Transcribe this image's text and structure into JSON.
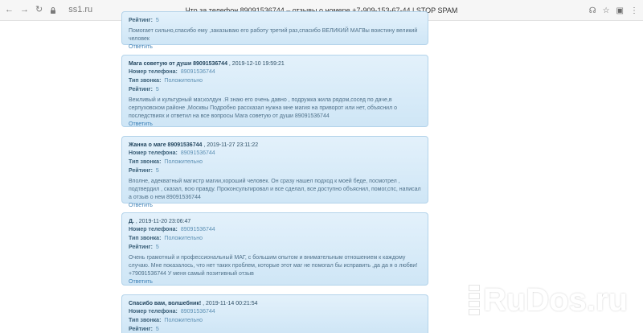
{
  "browser": {
    "url": "ss1.ru",
    "tab_title": "Что за телефон 89091536744 – отзывы о номере +7-909-153-67-44 | STOP SPAM",
    "colors": {
      "bar": "#f6f6f6"
    }
  },
  "labels": {
    "phone": "Номер телефона:",
    "call_type": "Тип звонка:",
    "rating": "Рейтинг:",
    "reply": "Ответить"
  },
  "comments": [
    {
      "author": "",
      "date": "",
      "phone": "",
      "call_type": "",
      "rating": "5",
      "text": "Помогает сильно,спасибо ему ,заказываю его работу третий раз,спасибо ВЕЛИКИЙ МАГВы воистину великий человек"
    },
    {
      "author": "Мага советую от души 89091536744",
      "date": ", 2019-12-10 19:59:21",
      "phone": "89091536744",
      "call_type": "Положительно",
      "rating": "5",
      "text": "Вежливый и культурный маг,колдун .Я знаю его очень давно , подружка жила рядом,сосед по даче,в серпуховском районе ,Москвы Подробно рассказал нужна мне магия на приворот или нет, объяснил о последствиях и ответил на все вопросы Мага советую от души 89091536744"
    },
    {
      "author": "Жанна о маге 89091536744",
      "date": ", 2019-11-27 23:11:22",
      "phone": "89091536744",
      "call_type": "Положительно",
      "rating": "5",
      "text": "Вполне, адекватный магистр магии,хороший человек. Он сразу нашел подход к моей беде, посмотрел , подтвердил , сказал, всю правду. Проконсультировал и все сделал, все доступно объяснил, помог,спс, написал а отзыв о нем 89091536744"
    },
    {
      "author": "Д.",
      "date": ", 2019-11-20 23:06:47",
      "phone": "89091536744",
      "call_type": "Положительно",
      "rating": "5",
      "text": "Очень грамотный и профессиональный МАГ, с большим опытом и внимательным отношением к каждому случаю. Мне показалось, что нет таких проблем, которые этот маг не помогал бы исправить ,да да я о любви! +79091536744 У меня самый позитивный отзыв"
    },
    {
      "author": "Спасибо вам, волшебник!",
      "date": ", 2019-11-14 00:21:54",
      "phone": "89091536744",
      "call_type": "Положительно",
      "rating": "5",
      "text": ""
    }
  ],
  "watermark": "RuDos.ru"
}
